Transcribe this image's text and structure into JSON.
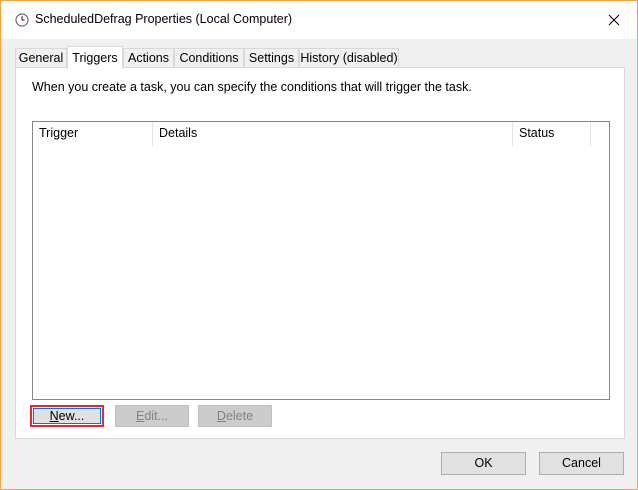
{
  "window": {
    "title": "ScheduledDefrag Properties (Local Computer)",
    "title_icon": "clock-icon",
    "close_icon": "close-icon"
  },
  "tabs": [
    {
      "label": "General",
      "active": false
    },
    {
      "label": "Triggers",
      "active": true
    },
    {
      "label": "Actions",
      "active": false
    },
    {
      "label": "Conditions",
      "active": false
    },
    {
      "label": "Settings",
      "active": false
    },
    {
      "label": "History (disabled)",
      "active": false
    }
  ],
  "triggers_tab": {
    "instruction": "When you create a task, you can specify the conditions that will trigger the task.",
    "columns": [
      "Trigger",
      "Details",
      "Status"
    ],
    "rows": [],
    "buttons": {
      "new_mnemonic": "N",
      "new_rest": "ew...",
      "edit_mnemonic": "E",
      "edit_rest": "dit...",
      "delete_mnemonic": "D",
      "delete_rest": "elete"
    }
  },
  "footer": {
    "ok_label": "OK",
    "cancel_label": "Cancel"
  },
  "colors": {
    "window_border": "#f0a44c",
    "focus_highlight": "#e0293a"
  }
}
